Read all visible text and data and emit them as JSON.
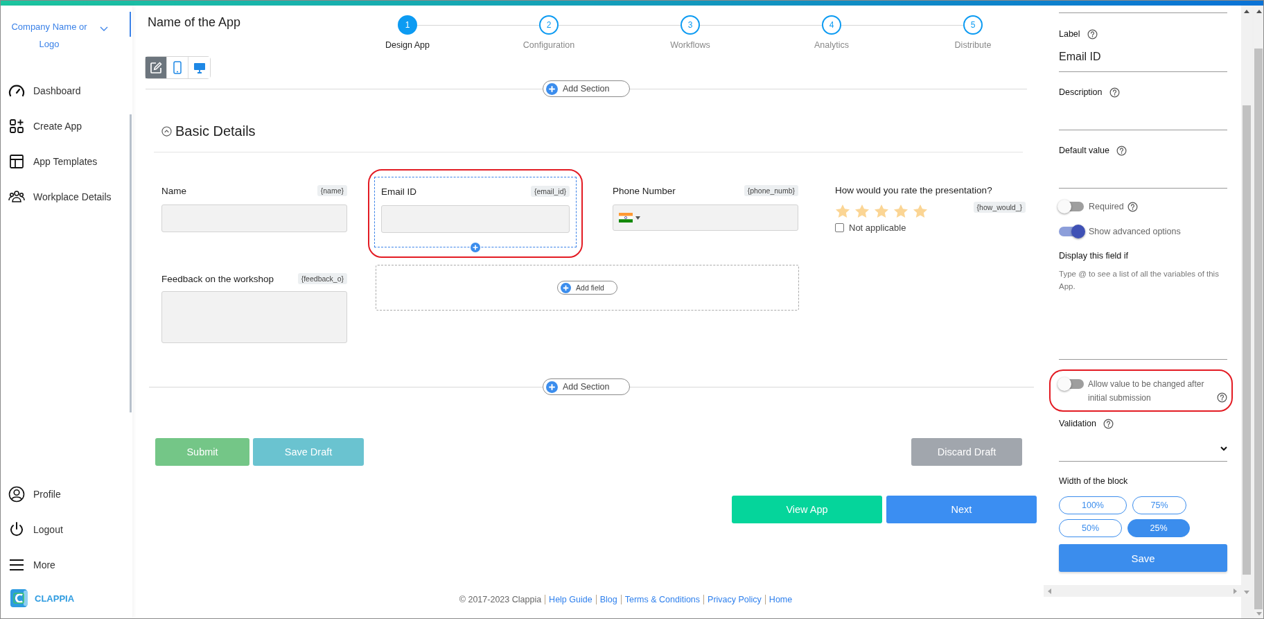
{
  "sidebar": {
    "company": "Company Name or Logo",
    "nav": [
      {
        "label": "Dashboard"
      },
      {
        "label": "Create App"
      },
      {
        "label": "App Templates"
      },
      {
        "label": "Workplace Details"
      }
    ],
    "bottom": [
      {
        "label": "Profile"
      },
      {
        "label": "Logout"
      },
      {
        "label": "More"
      }
    ],
    "brand": "CLAPPIA"
  },
  "header": {
    "title": "Name of the App",
    "steps": [
      {
        "number": "1",
        "label": "Design App",
        "selected": true
      },
      {
        "number": "2",
        "label": "Configuration",
        "selected": false
      },
      {
        "number": "3",
        "label": "Workflows",
        "selected": false
      },
      {
        "number": "4",
        "label": "Analytics",
        "selected": false
      },
      {
        "number": "5",
        "label": "Distribute",
        "selected": false
      }
    ],
    "view_modes": [
      {
        "kind": "edit",
        "selected": true
      },
      {
        "kind": "mobile",
        "selected": false
      },
      {
        "kind": "desktop",
        "selected": false
      }
    ]
  },
  "add_section_buttons": [
    "Add Section",
    "Add Section"
  ],
  "section": {
    "title": "Basic Details",
    "expanded": true
  },
  "fields": [
    {
      "kind": "text",
      "label": "Name",
      "variable": "{name}",
      "selected": false,
      "highlighted": false
    },
    {
      "kind": "text",
      "label": "Email ID",
      "variable": "{email_id}",
      "selected": true,
      "highlighted": true
    },
    {
      "kind": "phone",
      "label": "Phone Number",
      "variable": "{phone_numb}",
      "selected": false,
      "highlighted": false
    },
    {
      "kind": "rating",
      "label": "How would you rate the presentation?",
      "variable": "{how_would_}",
      "selected": false,
      "highlighted": false,
      "stars": 5,
      "not_applicable": {
        "label": "Not applicable",
        "checked": false
      }
    },
    {
      "kind": "textarea",
      "label": "Feedback on the workshop",
      "variable": "{feedback_o}",
      "selected": false,
      "highlighted": false
    }
  ],
  "add_field": "Add field",
  "form_buttons": [
    {
      "kind": "submit",
      "label": "Submit"
    },
    {
      "kind": "draft",
      "label": "Save Draft"
    },
    {
      "kind": "discard",
      "label": "Discard Draft"
    }
  ],
  "nav_buttons": [
    {
      "kind": "secondary",
      "label": "View App"
    },
    {
      "kind": "primary",
      "label": "Next"
    }
  ],
  "footer": {
    "copyright": "© 2017-2023 Clappia",
    "links": [
      "Help Guide",
      "Blog",
      "Terms & Conditions",
      "Privacy Policy",
      "Home"
    ]
  },
  "properties": {
    "label": {
      "title": "Label",
      "value": "Email ID"
    },
    "description": {
      "title": "Description"
    },
    "default_value": {
      "title": "Default value"
    },
    "toggles": [
      {
        "label": "Required",
        "on": false,
        "help": true
      },
      {
        "label": "Show advanced options",
        "on": true,
        "help": false
      }
    ],
    "display_condition": {
      "title": "Display this field if",
      "placeholder": "Type @ to see a list of all the variables of this App."
    },
    "allow_change": {
      "label": "Allow value to be changed after initial submission",
      "on": false,
      "highlighted": true
    },
    "validation": {
      "title": "Validation"
    },
    "width": {
      "title": "Width of the block",
      "options": [
        {
          "label": "100%",
          "selected": false
        },
        {
          "label": "75%",
          "selected": false
        },
        {
          "label": "50%",
          "selected": false
        },
        {
          "label": "25%",
          "selected": true
        }
      ]
    },
    "save": "Save"
  }
}
